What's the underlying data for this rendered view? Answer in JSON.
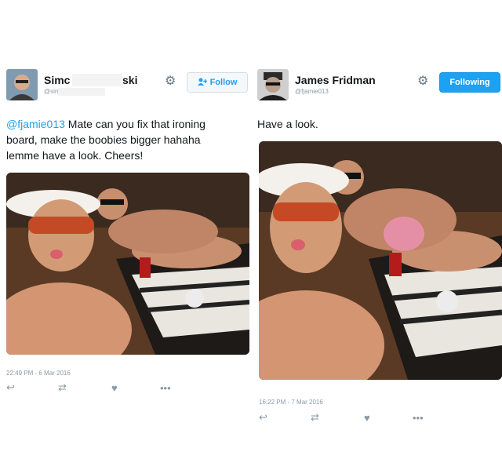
{
  "left_tweet": {
    "name_part1": "Simc",
    "name_part2": "ski",
    "handle": "@sim",
    "follow_label": "Follow",
    "mention": "@fjamie013",
    "text_line1": " Mate can you fix that ironing",
    "text_line2": "board, make the boobies bigger hahaha",
    "text_line3": "lemme have a look. Cheers!",
    "timestamp": "22:49 PM - 6 Mar 2016"
  },
  "right_tweet": {
    "name": "James Fridman",
    "handle": "@fjamie013",
    "follow_label": "Following",
    "text": "Have a look.",
    "timestamp": "16:22 PM - 7 Mar 2016"
  },
  "icons": [
    "reply-icon",
    "retweet-icon",
    "like-icon",
    "more-icon",
    "gear-icon",
    "add-user-icon"
  ],
  "colors": {
    "twitter_blue": "#1da1f2",
    "meta_gray": "#8899a6"
  }
}
